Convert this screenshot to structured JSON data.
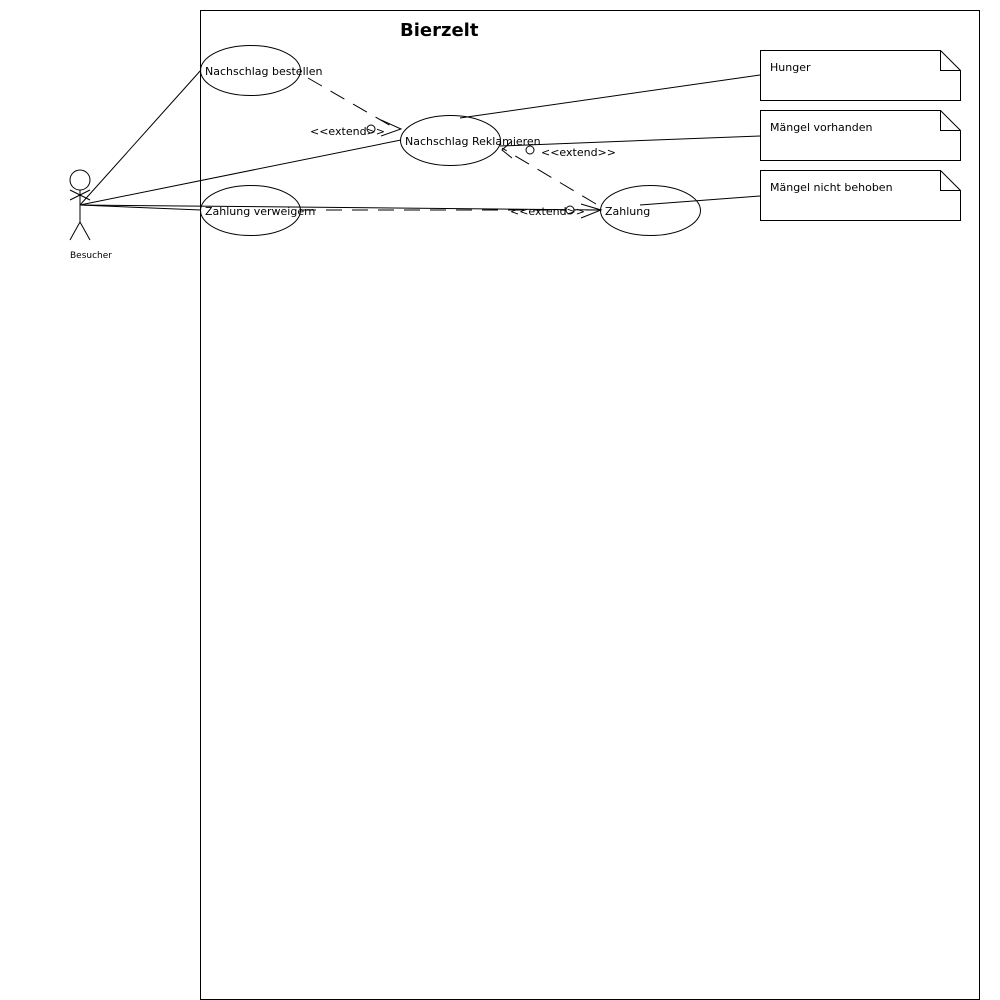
{
  "diagram": {
    "title": "Bierzelt",
    "actor": {
      "label": "Besucher"
    },
    "use_cases": {
      "nachschlag_bestellen": "Nachschlag bestellen",
      "nachschlag_reklamieren": "Nachschlag Reklamieren",
      "zahlung_verweigern": "Zahlung verweigern",
      "zahlung": "Zahlung"
    },
    "extend_label": "<<extend>>",
    "notes": {
      "hunger": "Hunger",
      "maengel_vorhanden": "Mängel vorhanden",
      "maengel_nicht_behoben": "Mängel nicht behoben"
    }
  }
}
